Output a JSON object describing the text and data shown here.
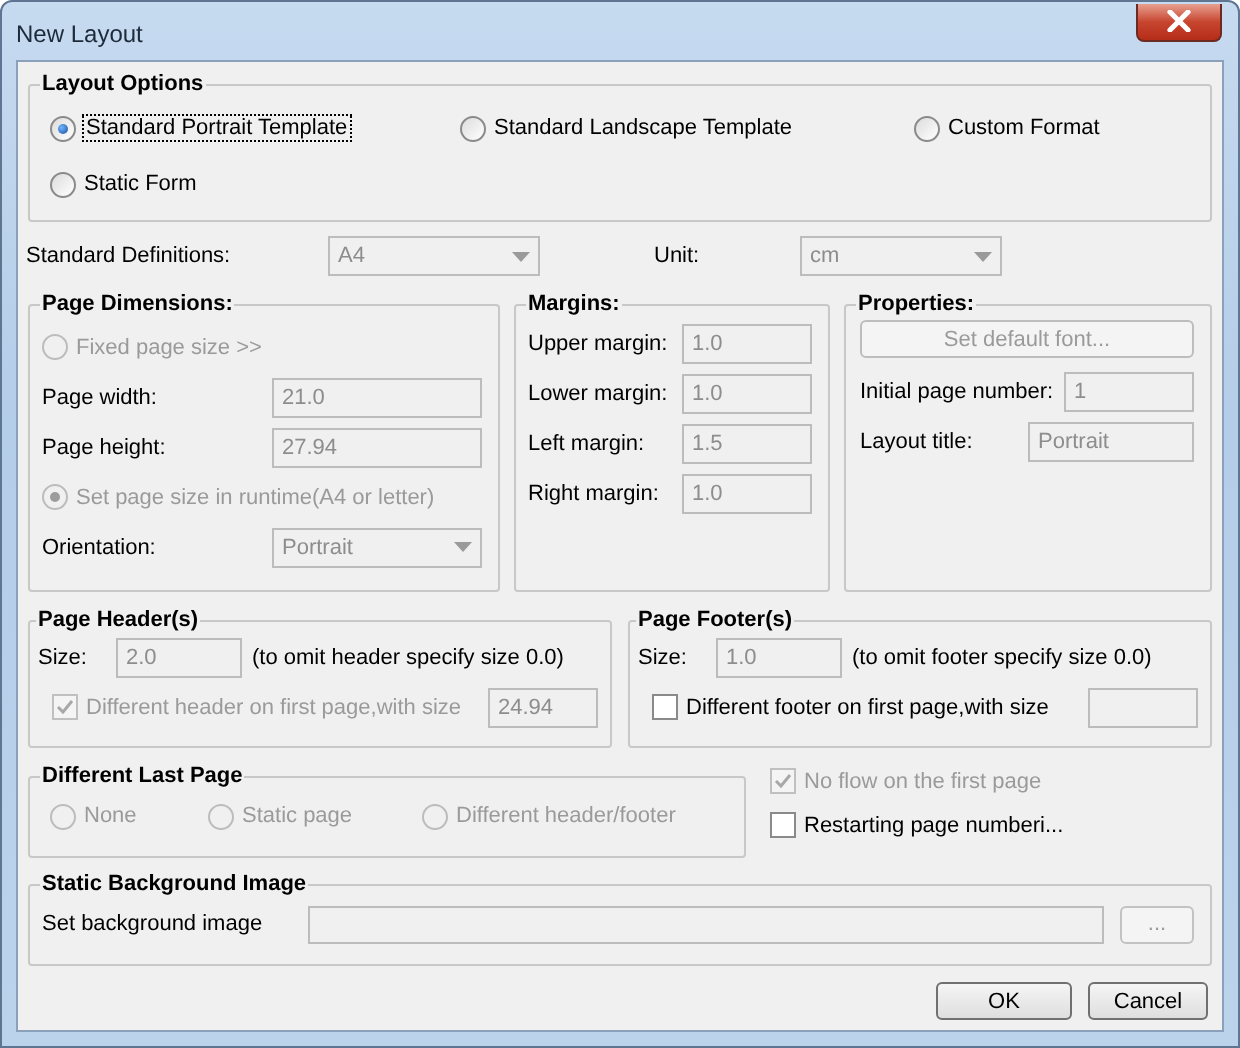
{
  "window": {
    "title": "New Layout"
  },
  "layout_options": {
    "title": "Layout Options",
    "options": [
      {
        "label": "Standard Portrait Template",
        "selected": true,
        "focused": true
      },
      {
        "label": "Standard Landscape Template",
        "selected": false,
        "focused": false
      },
      {
        "label": "Custom Format",
        "selected": false,
        "focused": false
      },
      {
        "label": "Static Form",
        "selected": false,
        "focused": false
      }
    ]
  },
  "standard_definitions": {
    "label": "Standard Definitions:",
    "value": "A4"
  },
  "unit": {
    "label": "Unit:",
    "value": "cm"
  },
  "page_dimensions": {
    "title": "Page Dimensions:",
    "fixed_size": {
      "label": "Fixed page size >>",
      "selected": false,
      "disabled": true
    },
    "fields": [
      {
        "label": "Page width:",
        "value": "21.0"
      },
      {
        "label": "Page height:",
        "value": "27.94"
      }
    ],
    "runtime_size": {
      "label": "Set page size in runtime(A4 or letter)",
      "selected": true,
      "disabled": true
    },
    "orientation": {
      "label": "Orientation:",
      "value": "Portrait"
    }
  },
  "margins": {
    "title": "Margins:",
    "fields": [
      {
        "label": "Upper margin:",
        "value": "1.0"
      },
      {
        "label": "Lower margin:",
        "value": "1.0"
      },
      {
        "label": "Left margin:",
        "value": "1.5"
      },
      {
        "label": "Right margin:",
        "value": "1.0"
      }
    ]
  },
  "properties": {
    "title": "Properties:",
    "font_button": {
      "label": "Set default font...",
      "disabled": true
    },
    "fields": [
      {
        "label": "Initial page number:",
        "value": "1"
      },
      {
        "label": "Layout title:",
        "value": "Portrait"
      }
    ]
  },
  "page_header": {
    "title": "Page Header(s)",
    "size_label": "Size:",
    "size": "2.0",
    "hint": "(to omit header specify size 0.0)",
    "first_page": {
      "label": "Different header on first page,with size",
      "checked": true,
      "disabled": true
    },
    "first_page_size": "24.94"
  },
  "page_footer": {
    "title": "Page Footer(s)",
    "size_label": "Size:",
    "size": "1.0",
    "hint": "(to omit footer specify size 0.0)",
    "first_page": {
      "label": "Different footer on first page,with size",
      "checked": false,
      "disabled": false
    }
  },
  "different_last_page": {
    "title": "Different Last Page",
    "options": [
      {
        "label": "None",
        "selected": false,
        "disabled": true
      },
      {
        "label": "Static page",
        "selected": false,
        "disabled": true
      },
      {
        "label": "Different header/footer",
        "selected": false,
        "disabled": true
      }
    ]
  },
  "flow_options": [
    {
      "label": "No flow on the first page",
      "checked": true,
      "disabled": true
    },
    {
      "label": "Restarting page numberi...",
      "checked": false,
      "disabled": false
    }
  ],
  "background_image": {
    "title": "Static Background Image",
    "label": "Set background image",
    "browse_button": {
      "label": "...",
      "disabled": true
    }
  },
  "buttons": [
    {
      "label": "OK"
    },
    {
      "label": "Cancel"
    }
  ]
}
